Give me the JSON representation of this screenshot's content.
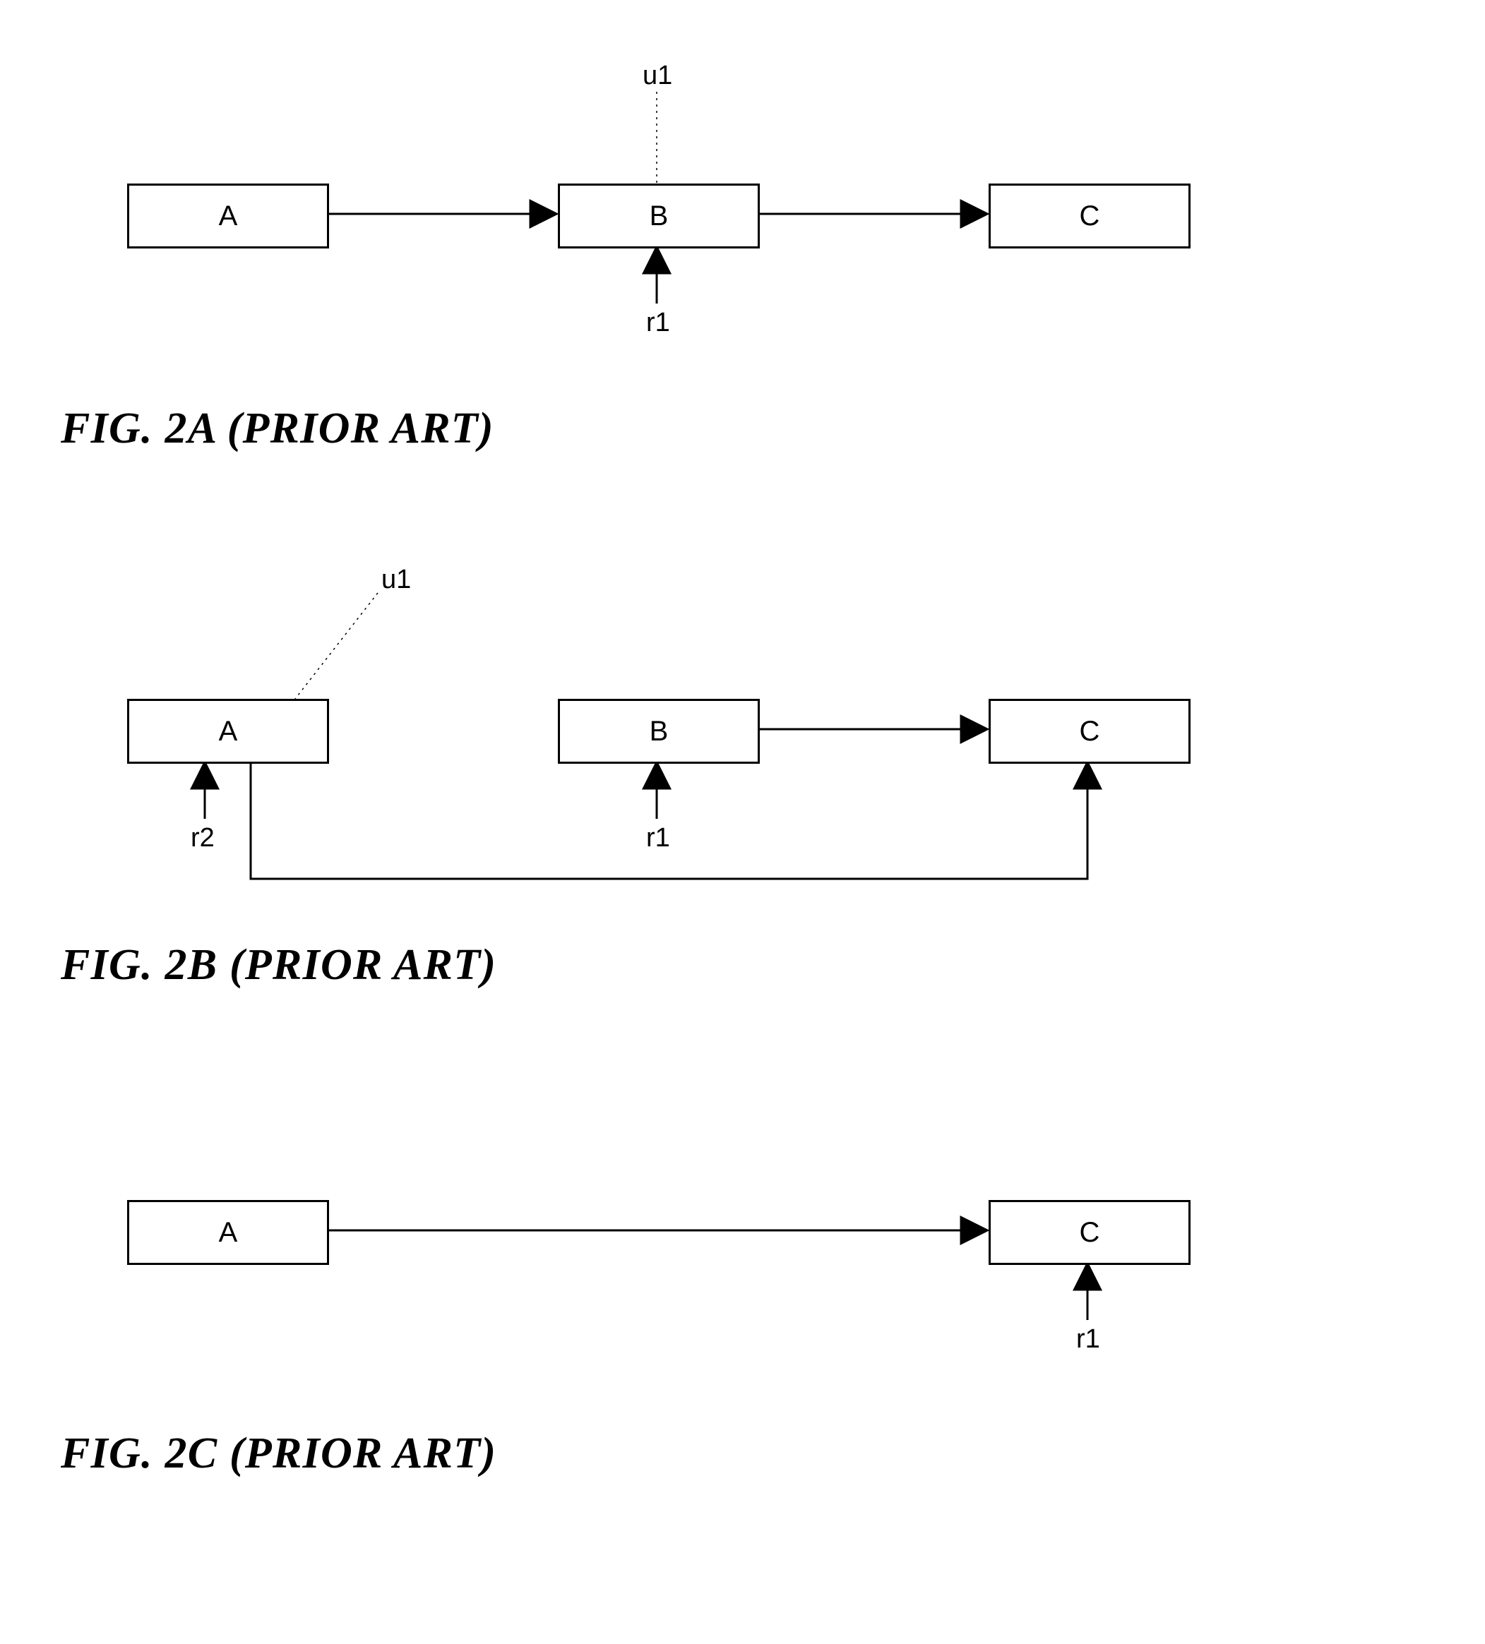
{
  "fig2a": {
    "caption": "FIG. 2A (PRIOR ART)",
    "nodes": {
      "A": "A",
      "B": "B",
      "C": "C"
    },
    "labels": {
      "u1": "u1",
      "r1": "r1"
    }
  },
  "fig2b": {
    "caption": "FIG. 2B (PRIOR ART)",
    "nodes": {
      "A": "A",
      "B": "B",
      "C": "C"
    },
    "labels": {
      "u1": "u1",
      "r1": "r1",
      "r2": "r2"
    }
  },
  "fig2c": {
    "caption": "FIG. 2C (PRIOR ART)",
    "nodes": {
      "A": "A",
      "C": "C"
    },
    "labels": {
      "r1": "r1"
    }
  }
}
